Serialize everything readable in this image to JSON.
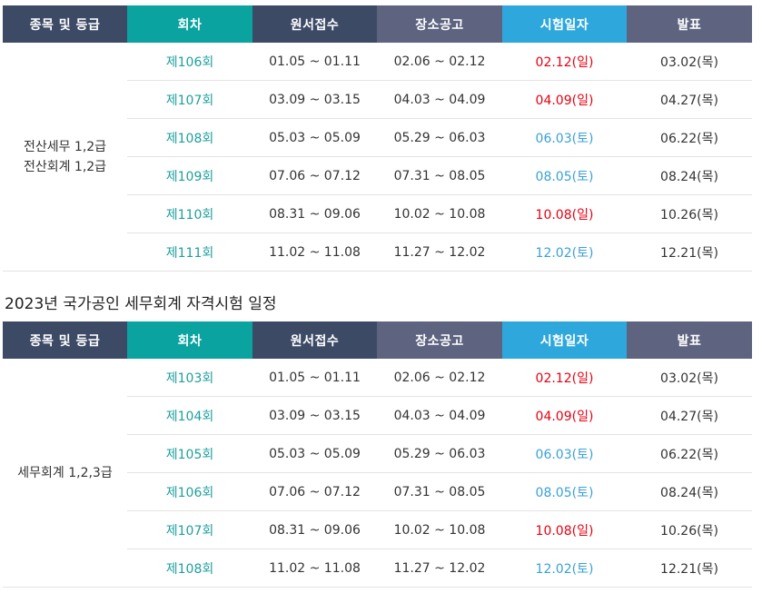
{
  "headers": [
    "종목 및 등급",
    "회차",
    "원서접수",
    "장소공고",
    "시험일자",
    "발표"
  ],
  "colors": {
    "exam_sun": "#e60012",
    "exam_sat": "#3aa0d8",
    "round": "#1e9f9c"
  },
  "table1": {
    "category_lines": [
      "전산세무 1,2급",
      "전산회계 1,2급"
    ],
    "rows": [
      {
        "round": "제106회",
        "apply": "01.05 ~ 01.11",
        "notice": "02.06 ~ 02.12",
        "exam": "02.12(일)",
        "exam_day": "sun",
        "result": "03.02(목)"
      },
      {
        "round": "제107회",
        "apply": "03.09 ~ 03.15",
        "notice": "04.03 ~ 04.09",
        "exam": "04.09(일)",
        "exam_day": "sun",
        "result": "04.27(목)"
      },
      {
        "round": "제108회",
        "apply": "05.03 ~ 05.09",
        "notice": "05.29 ~ 06.03",
        "exam": "06.03(토)",
        "exam_day": "sat",
        "result": "06.22(목)"
      },
      {
        "round": "제109회",
        "apply": "07.06 ~ 07.12",
        "notice": "07.31 ~ 08.05",
        "exam": "08.05(토)",
        "exam_day": "sat",
        "result": "08.24(목)"
      },
      {
        "round": "제110회",
        "apply": "08.31 ~ 09.06",
        "notice": "10.02 ~ 10.08",
        "exam": "10.08(일)",
        "exam_day": "sun",
        "result": "10.26(목)"
      },
      {
        "round": "제111회",
        "apply": "11.02 ~ 11.08",
        "notice": "11.27 ~ 12.02",
        "exam": "12.02(토)",
        "exam_day": "sat",
        "result": "12.21(목)"
      }
    ]
  },
  "section_title": "2023년 국가공인 세무회계 자격시험 일정",
  "table2": {
    "category_lines": [
      "세무회계 1,2,3급"
    ],
    "rows": [
      {
        "round": "제103회",
        "apply": "01.05 ~ 01.11",
        "notice": "02.06 ~ 02.12",
        "exam": "02.12(일)",
        "exam_day": "sun",
        "result": "03.02(목)"
      },
      {
        "round": "제104회",
        "apply": "03.09 ~ 03.15",
        "notice": "04.03 ~ 04.09",
        "exam": "04.09(일)",
        "exam_day": "sun",
        "result": "04.27(목)"
      },
      {
        "round": "제105회",
        "apply": "05.03 ~ 05.09",
        "notice": "05.29 ~ 06.03",
        "exam": "06.03(토)",
        "exam_day": "sat",
        "result": "06.22(목)"
      },
      {
        "round": "제106회",
        "apply": "07.06 ~ 07.12",
        "notice": "07.31 ~ 08.05",
        "exam": "08.05(토)",
        "exam_day": "sat",
        "result": "08.24(목)"
      },
      {
        "round": "제107회",
        "apply": "08.31 ~ 09.06",
        "notice": "10.02 ~ 10.08",
        "exam": "10.08(일)",
        "exam_day": "sun",
        "result": "10.26(목)"
      },
      {
        "round": "제108회",
        "apply": "11.02 ~ 11.08",
        "notice": "11.27 ~ 12.02",
        "exam": "12.02(토)",
        "exam_day": "sat",
        "result": "12.21(목)"
      }
    ]
  }
}
